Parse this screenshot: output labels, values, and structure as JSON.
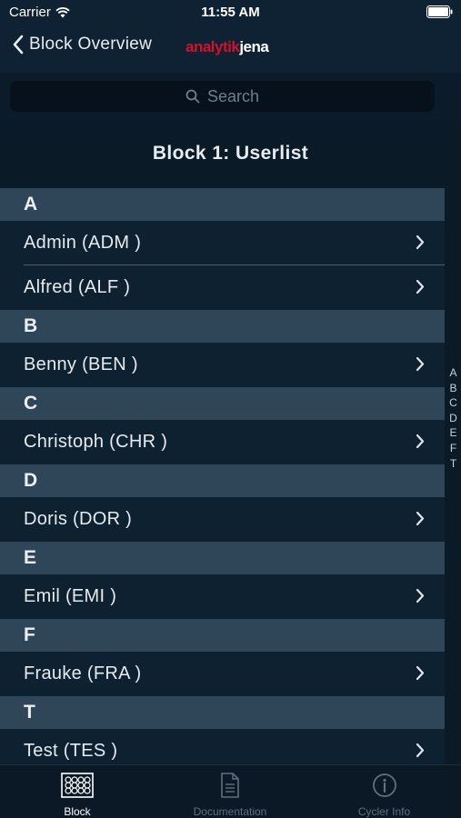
{
  "status_bar": {
    "carrier": "Carrier",
    "time": "11:55 AM"
  },
  "nav": {
    "back_label": "Block Overview",
    "brand_part1": "analytik",
    "brand_part2": "jena"
  },
  "search": {
    "placeholder": "Search"
  },
  "page_title": "Block 1: Userlist",
  "sections": [
    {
      "letter": "A",
      "items": [
        "Admin (ADM )",
        "Alfred (ALF )"
      ]
    },
    {
      "letter": "B",
      "items": [
        "Benny (BEN )"
      ]
    },
    {
      "letter": "C",
      "items": [
        "Christoph (CHR )"
      ]
    },
    {
      "letter": "D",
      "items": [
        "Doris (DOR )"
      ]
    },
    {
      "letter": "E",
      "items": [
        "Emil (EMI )"
      ]
    },
    {
      "letter": "F",
      "items": [
        "Frauke (FRA )"
      ]
    },
    {
      "letter": "T",
      "items": [
        "Test (TES )"
      ]
    }
  ],
  "section_index": [
    "A",
    "B",
    "C",
    "D",
    "E",
    "F",
    "T"
  ],
  "tabs": [
    {
      "label": "Block",
      "icon": "grid-icon",
      "active": true
    },
    {
      "label": "Documentation",
      "icon": "document-icon",
      "active": false
    },
    {
      "label": "Cycler Info",
      "icon": "info-icon",
      "active": false
    }
  ],
  "colors": {
    "background": "#0a1a27",
    "section_header": "#2e4658",
    "brand_red": "#d4102a",
    "tab_active": "#ffffff",
    "tab_inactive": "#5f7080"
  }
}
